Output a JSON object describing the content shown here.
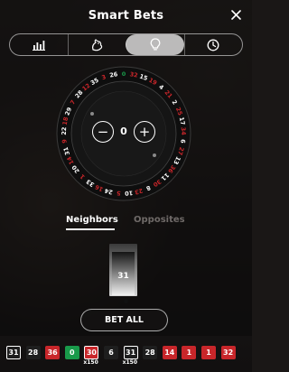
{
  "header": {
    "title": "Smart Bets",
    "close_icon": "close-icon"
  },
  "tabs": [
    {
      "icon": "bar-chart-icon",
      "active": false
    },
    {
      "icon": "dragon-icon",
      "active": false
    },
    {
      "icon": "lightbulb-icon",
      "active": true
    },
    {
      "icon": "clock-icon",
      "active": false
    }
  ],
  "wheel": {
    "numbers": [
      "0",
      "32",
      "15",
      "19",
      "4",
      "21",
      "2",
      "25",
      "17",
      "34",
      "6",
      "27",
      "13",
      "36",
      "11",
      "30",
      "8",
      "23",
      "10",
      "5",
      "24",
      "16",
      "33",
      "1",
      "20",
      "14",
      "31",
      "9",
      "22",
      "18",
      "29",
      "7",
      "28",
      "12",
      "35",
      "3",
      "26"
    ],
    "red_numbers": [
      "1",
      "3",
      "5",
      "7",
      "9",
      "12",
      "14",
      "16",
      "18",
      "19",
      "21",
      "23",
      "25",
      "27",
      "30",
      "32",
      "34",
      "36"
    ],
    "neighbors_count": "0",
    "minus_label": "−",
    "plus_label": "+"
  },
  "modes": {
    "neighbors": "Neighbors",
    "opposites": "Opposites",
    "selected": "neighbors"
  },
  "slider": {
    "value": "31"
  },
  "bet_all_label": "BET ALL",
  "history": [
    {
      "value": "31",
      "color": "black",
      "boxed": true,
      "multiplier": ""
    },
    {
      "value": "28",
      "color": "black",
      "boxed": false,
      "multiplier": ""
    },
    {
      "value": "36",
      "color": "red",
      "boxed": false,
      "multiplier": ""
    },
    {
      "value": "0",
      "color": "green",
      "boxed": false,
      "multiplier": ""
    },
    {
      "value": "30",
      "color": "red",
      "boxed": true,
      "multiplier": "x150"
    },
    {
      "value": "6",
      "color": "black",
      "boxed": false,
      "multiplier": ""
    },
    {
      "value": "31",
      "color": "black",
      "boxed": true,
      "multiplier": "x150"
    },
    {
      "value": "28",
      "color": "black",
      "boxed": false,
      "multiplier": ""
    },
    {
      "value": "14",
      "color": "red",
      "boxed": false,
      "multiplier": ""
    },
    {
      "value": "1",
      "color": "red",
      "boxed": false,
      "multiplier": ""
    },
    {
      "value": "1",
      "color": "red",
      "boxed": false,
      "multiplier": ""
    },
    {
      "value": "32",
      "color": "red",
      "boxed": false,
      "multiplier": ""
    }
  ],
  "colors": {
    "red": "#c8262a",
    "green": "#199a4a",
    "black": "#1e1e1e",
    "active_tab": "#cdcdcd"
  }
}
